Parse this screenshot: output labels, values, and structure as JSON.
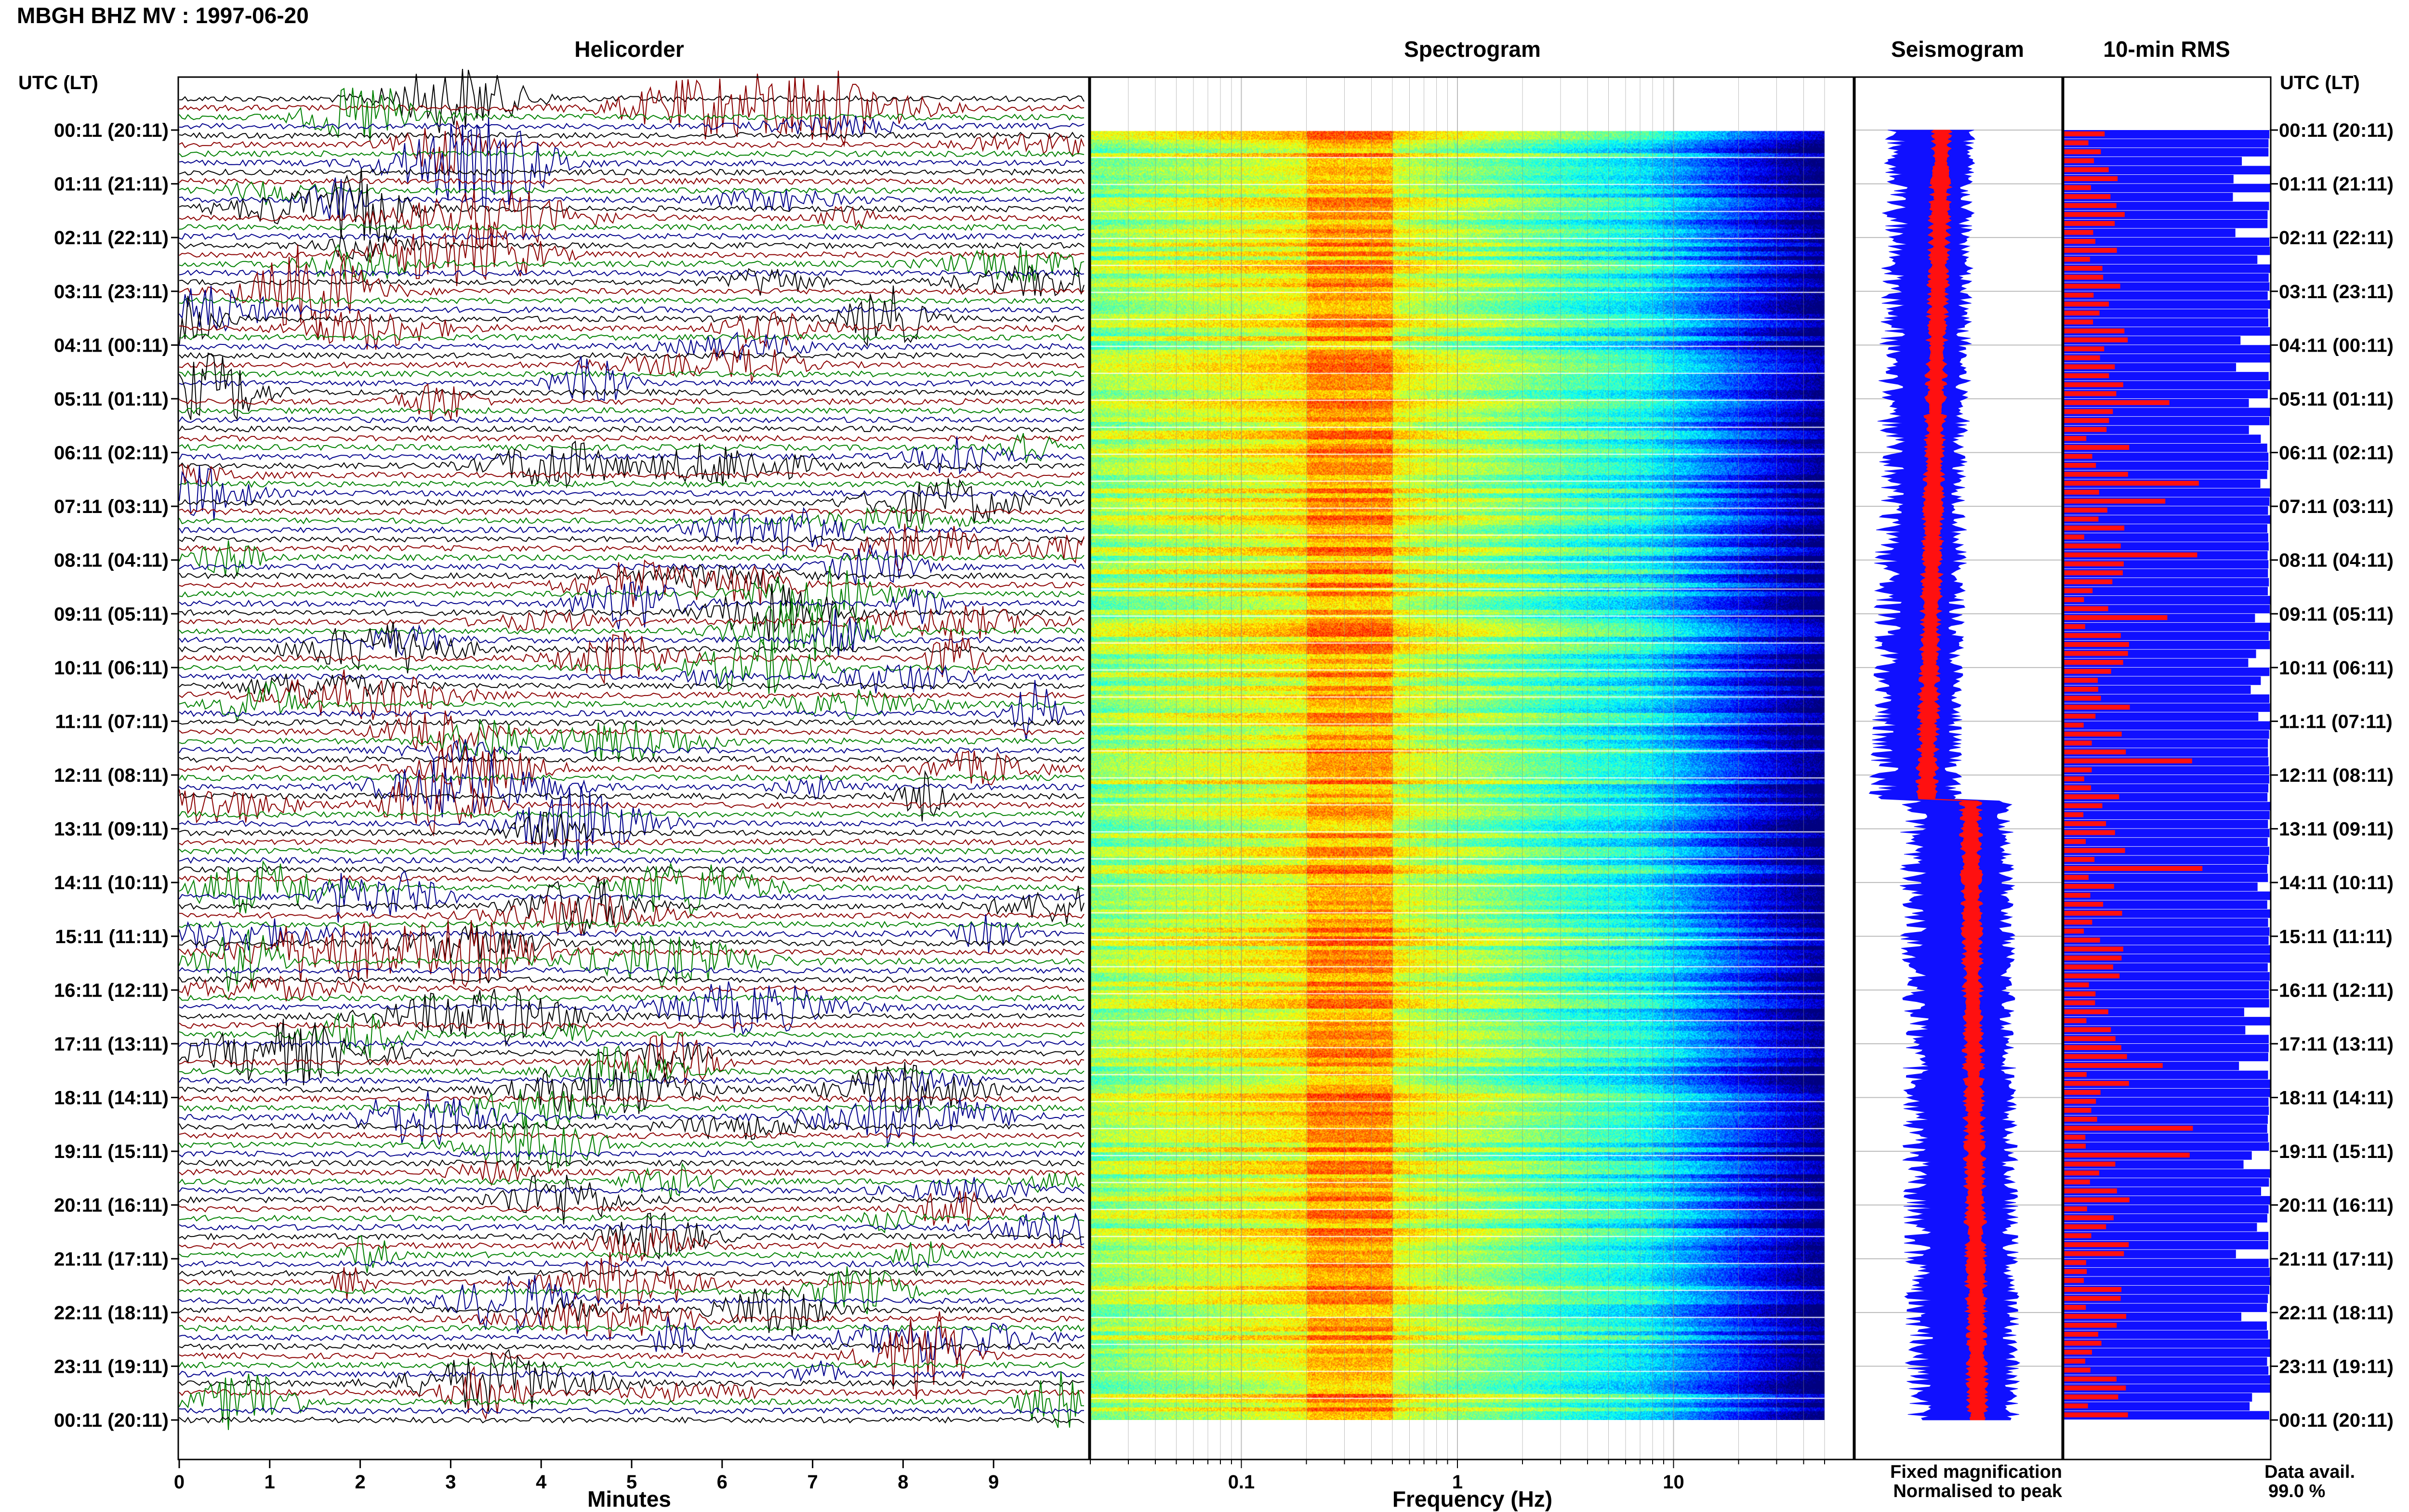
{
  "header": {
    "title": "MBGH BHZ MV : 1997-06-20"
  },
  "panels": {
    "helicorder": "Helicorder",
    "spectrogram": "Spectrogram",
    "seismogram": "Seismogram",
    "rms": "10-min RMS"
  },
  "axes": {
    "left_header": "UTC (LT)",
    "right_header": "UTC (LT)",
    "time_labels": [
      "00:11 (20:11)",
      "01:11 (21:11)",
      "02:11 (22:11)",
      "03:11 (23:11)",
      "04:11 (00:11)",
      "05:11 (01:11)",
      "06:11 (02:11)",
      "07:11 (03:11)",
      "08:11 (04:11)",
      "09:11 (05:11)",
      "10:11 (06:11)",
      "11:11 (07:11)",
      "12:11 (08:11)",
      "13:11 (09:11)",
      "14:11 (10:11)",
      "15:11 (11:11)",
      "16:11 (12:11)",
      "17:11 (13:11)",
      "18:11 (14:11)",
      "19:11 (15:11)",
      "20:11 (16:11)",
      "21:11 (17:11)",
      "22:11 (18:11)",
      "23:11 (19:11)",
      "00:11 (20:11)"
    ],
    "minutes_label": "Minutes",
    "minutes_ticks": [
      "0",
      "1",
      "2",
      "3",
      "4",
      "5",
      "6",
      "7",
      "8",
      "9"
    ],
    "frequency_label": "Frequency (Hz)",
    "frequency_ticks": [
      "0.1",
      "1",
      "10"
    ]
  },
  "legend": {
    "fixed": "Fixed magnification",
    "normalised": "Normalised to peak",
    "fixed_color": "#1010ff",
    "normalised_color": "#ff1010"
  },
  "data_availability": {
    "label": "Data avail.",
    "value": "99.0 %"
  },
  "chart_data": [
    {
      "type": "line",
      "panel": "Helicorder",
      "xlabel": "Minutes",
      "xlim": [
        0,
        10
      ],
      "rows_per_day": 144,
      "trace_colors": [
        "#000000",
        "#8b0000",
        "#008000",
        "#00008b"
      ]
    },
    {
      "type": "heatmap",
      "panel": "Spectrogram",
      "xlabel": "Frequency (Hz)",
      "xscale": "log",
      "xlim": [
        0.02,
        50
      ],
      "colormap": "jet",
      "dominant_band_hz": [
        0.2,
        0.5
      ]
    },
    {
      "type": "line",
      "panel": "Seismogram",
      "series": [
        {
          "name": "Fixed magnification",
          "color": "#1010ff"
        },
        {
          "name": "Normalised to peak",
          "color": "#ff1010"
        }
      ]
    },
    {
      "type": "bar",
      "panel": "10-min RMS",
      "bar_colors": [
        "#1010ff",
        "#ff1010"
      ]
    }
  ]
}
